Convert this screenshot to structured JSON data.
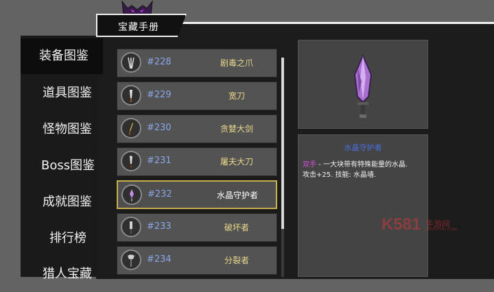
{
  "window": {
    "title": "宝藏手册"
  },
  "sidebar": {
    "items": [
      {
        "label": "装备图鉴",
        "active": true
      },
      {
        "label": "道具图鉴"
      },
      {
        "label": "怪物图鉴"
      },
      {
        "label": "Boss图鉴"
      },
      {
        "label": "成就图鉴"
      },
      {
        "label": "排行榜"
      },
      {
        "label": "猎人宝藏"
      }
    ]
  },
  "list": {
    "rows": [
      {
        "num": "#228",
        "name": "剧毒之爪",
        "icon": "claw-icon"
      },
      {
        "num": "#229",
        "name": "宽刀",
        "icon": "broad-knife-icon"
      },
      {
        "num": "#230",
        "name": "贪婪大剑",
        "icon": "greatsword-icon"
      },
      {
        "num": "#231",
        "name": "屠夫大刀",
        "icon": "butcher-blade-icon"
      },
      {
        "num": "#232",
        "name": "水晶守护者",
        "icon": "crystal-sword-icon",
        "selected": true
      },
      {
        "num": "#233",
        "name": "破坏者",
        "icon": "destroyer-blade-icon"
      },
      {
        "num": "#234",
        "name": "分裂者",
        "icon": "splitter-axe-icon"
      }
    ]
  },
  "detail": {
    "title": "水晶守护者",
    "tag": "双手",
    "desc1": " - 一大块带有特殊能量的水晶.",
    "desc2": "攻击+25. 技能: 水晶墙."
  },
  "watermark": {
    "brand": "K581",
    "text1": "手游网",
    "text2": "SHOUYOU.COM"
  },
  "colors": {
    "accent": "#c9b24c",
    "number": "#8aa6e6",
    "itemName": "#e9d88a",
    "detailTitle": "#4a6fe0",
    "tag": "#d94dd9"
  }
}
